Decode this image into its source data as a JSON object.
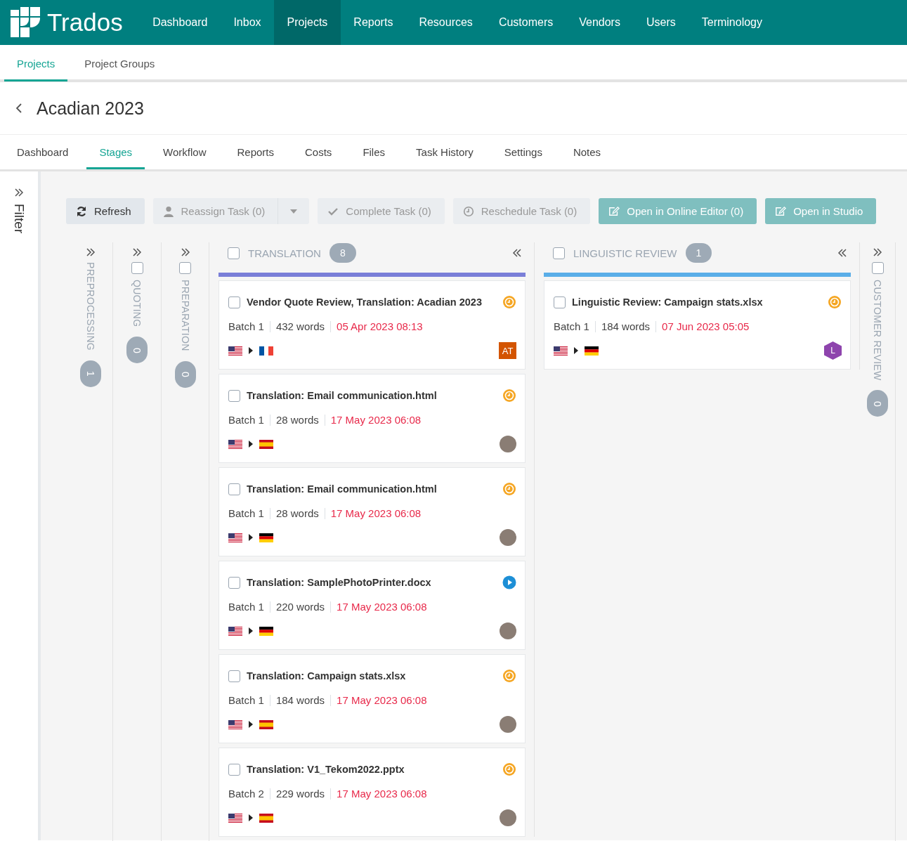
{
  "brand": "Trados",
  "nav": [
    {
      "label": "Dashboard",
      "selected": false
    },
    {
      "label": "Inbox",
      "selected": false
    },
    {
      "label": "Projects",
      "selected": true
    },
    {
      "label": "Reports",
      "selected": false
    },
    {
      "label": "Resources",
      "selected": false
    },
    {
      "label": "Customers",
      "selected": false
    },
    {
      "label": "Vendors",
      "selected": false
    },
    {
      "label": "Users",
      "selected": false
    },
    {
      "label": "Terminology",
      "selected": false
    }
  ],
  "subnav": [
    {
      "label": "Projects",
      "selected": true
    },
    {
      "label": "Project Groups",
      "selected": false
    }
  ],
  "project": {
    "title": "Acadian 2023"
  },
  "project_tabs": [
    {
      "label": "Dashboard",
      "selected": false
    },
    {
      "label": "Stages",
      "selected": true
    },
    {
      "label": "Workflow",
      "selected": false
    },
    {
      "label": "Reports",
      "selected": false
    },
    {
      "label": "Costs",
      "selected": false
    },
    {
      "label": "Files",
      "selected": false
    },
    {
      "label": "Task History",
      "selected": false
    },
    {
      "label": "Settings",
      "selected": false
    },
    {
      "label": "Notes",
      "selected": false
    }
  ],
  "filter": {
    "label": "Filter"
  },
  "toolbar": [
    {
      "label": "Refresh",
      "kind": "default"
    },
    {
      "label": "Reassign Task (0)",
      "kind": "split"
    },
    {
      "label": "Complete Task (0)",
      "kind": "disabled"
    },
    {
      "label": "Reschedule Task (0)",
      "kind": "disabled"
    },
    {
      "label": "Open in Online Editor (0)",
      "kind": "primary"
    },
    {
      "label": "Open in Studio",
      "kind": "primary"
    }
  ],
  "stages": [
    {
      "kind": "collapsed",
      "name": "PREPROCESSING",
      "count": "1"
    },
    {
      "kind": "collapsed",
      "name": "QUOTING",
      "count": "0",
      "checked": false
    },
    {
      "kind": "collapsed",
      "name": "PREPARATION",
      "count": "0",
      "checked": false
    },
    {
      "kind": "expanded",
      "name": "TRANSLATION",
      "count": "8",
      "checked": false,
      "color": "#7a7fd8",
      "tasks": [
        {
          "title": "Vendor Quote Review, Translation: Acadian 2023",
          "checked": false,
          "in_progress": false,
          "batch": "Batch 1",
          "words": "432 words",
          "due": "05 Apr 2023 08:13",
          "flags": [
            {
              "kind": "us"
            },
            {
              "kind": "fr"
            }
          ],
          "assignee": {
            "kind": "initials",
            "text": "AT",
            "color": "#d35400"
          }
        },
        {
          "title": "Translation: Email communication.html",
          "checked": false,
          "in_progress": false,
          "batch": "Batch 1",
          "words": "28 words",
          "due": "17 May 2023 06:08",
          "flags": [
            {
              "kind": "us"
            },
            {
              "kind": "es"
            }
          ],
          "assignee": {
            "kind": "photo"
          }
        },
        {
          "title": "Translation: Email communication.html",
          "checked": false,
          "in_progress": false,
          "batch": "Batch 1",
          "words": "28 words",
          "due": "17 May 2023 06:08",
          "flags": [
            {
              "kind": "us"
            },
            {
              "kind": "de"
            }
          ],
          "assignee": {
            "kind": "photo"
          }
        },
        {
          "title": "Translation: SamplePhotoPrinter.docx",
          "checked": false,
          "in_progress": true,
          "batch": "Batch 1",
          "words": "220 words",
          "due": "17 May 2023 06:08",
          "flags": [
            {
              "kind": "us"
            },
            {
              "kind": "de"
            }
          ],
          "assignee": {
            "kind": "photo"
          }
        },
        {
          "title": "Translation: Campaign stats.xlsx",
          "checked": false,
          "in_progress": false,
          "batch": "Batch 1",
          "words": "184 words",
          "due": "17 May 2023 06:08",
          "flags": [
            {
              "kind": "us"
            },
            {
              "kind": "es"
            }
          ],
          "assignee": {
            "kind": "photo"
          }
        },
        {
          "title": "Translation: V1_Tekom2022.pptx",
          "checked": false,
          "in_progress": false,
          "batch": "Batch 2",
          "words": "229 words",
          "due": "17 May 2023 06:08",
          "flags": [
            {
              "kind": "us"
            },
            {
              "kind": "es"
            }
          ],
          "assignee": {
            "kind": "photo"
          }
        }
      ]
    },
    {
      "kind": "expanded",
      "name": "LINGUISTIC REVIEW",
      "count": "1",
      "checked": false,
      "color": "#5aaee8",
      "tasks": [
        {
          "title": "Linguistic Review: Campaign stats.xlsx",
          "checked": false,
          "in_progress": false,
          "batch": "Batch 1",
          "words": "184 words",
          "due": "07 Jun 2023 05:05",
          "flags": [
            {
              "kind": "us"
            },
            {
              "kind": "de"
            }
          ],
          "assignee": {
            "kind": "hexagon",
            "text": "L",
            "color": "#8e44ad"
          }
        }
      ]
    },
    {
      "kind": "collapsed",
      "name": "CUSTOMER REVIEW",
      "count": "0",
      "checked": false
    }
  ]
}
